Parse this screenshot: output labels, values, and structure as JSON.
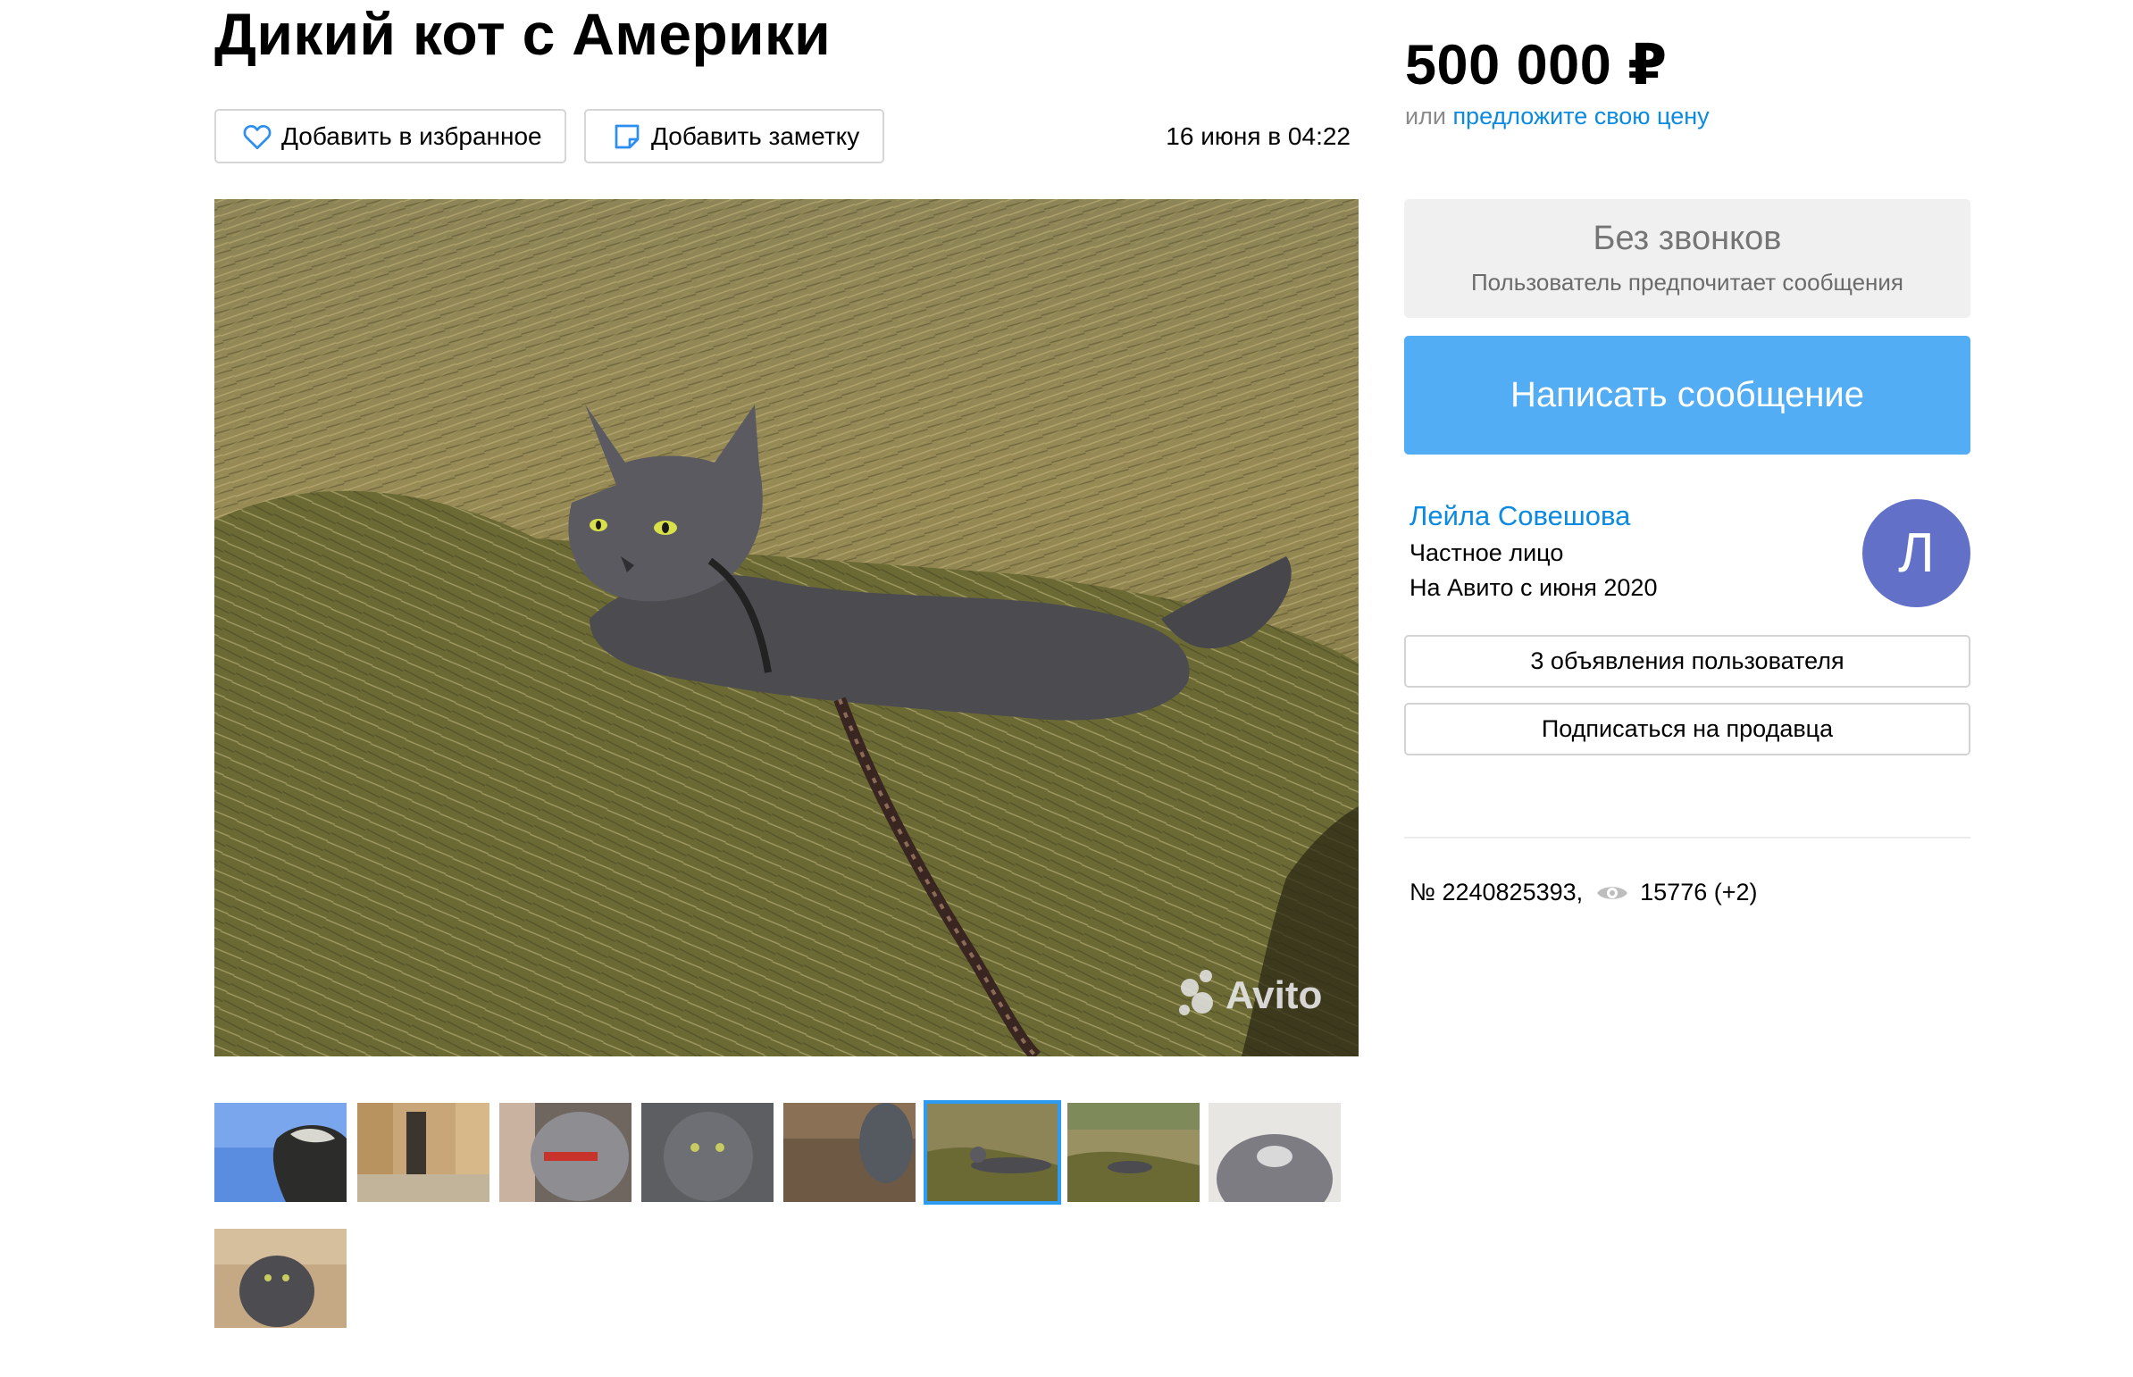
{
  "listing": {
    "title": "Дикий кот с Америки",
    "favorite_label": "Добавить в избранное",
    "note_label": "Добавить заметку",
    "date": "16 июня в 04:22",
    "photo_watermark": "Avito",
    "thumbnails_count": 9,
    "active_thumbnail": 6
  },
  "price": {
    "amount": "500 000 ₽",
    "offer_prefix": "или",
    "offer_link": "предложите свою цену"
  },
  "contact": {
    "no_calls_title": "Без звонков",
    "no_calls_subtitle": "Пользователь предпочитает сообщения",
    "message_button": "Написать сообщение"
  },
  "seller": {
    "name": "Лейла Совешова",
    "type": "Частное лицо",
    "since": "На Авито с июня 2020",
    "avatar_letter": "Л",
    "avatar_color": "#6270c8",
    "ads_button": "3 объявления пользователя",
    "subscribe_button": "Подписаться на продавца"
  },
  "stats": {
    "number": "№ 2240825393,",
    "views": "15776 (+2)"
  },
  "colors": {
    "accent": "#53adf5",
    "link": "#0a8ae0",
    "thumb_active": "#2d9cf0"
  },
  "icons": {
    "favorite": "heart-outline-icon",
    "note": "sticky-note-icon",
    "views": "eye-icon"
  }
}
